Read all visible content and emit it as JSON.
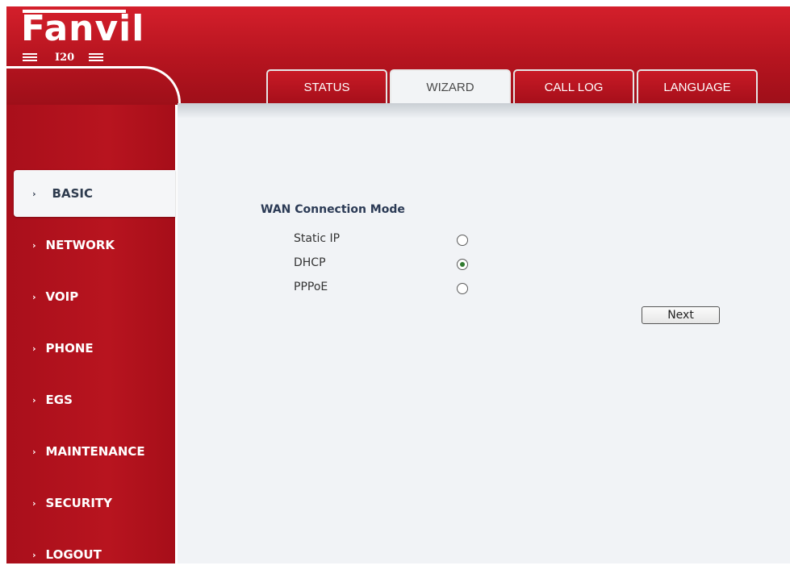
{
  "brand": {
    "logo": "Fanvil",
    "model": "I20"
  },
  "tabs": [
    {
      "label": "STATUS"
    },
    {
      "label": "WIZARD",
      "active": true
    },
    {
      "label": "CALL LOG"
    },
    {
      "label": "LANGUAGE"
    }
  ],
  "sidebar": {
    "items": [
      {
        "label": "BASIC",
        "active": true
      },
      {
        "label": "NETWORK"
      },
      {
        "label": "VOIP"
      },
      {
        "label": "PHONE"
      },
      {
        "label": "EGS"
      },
      {
        "label": "MAINTENANCE"
      },
      {
        "label": "SECURITY"
      },
      {
        "label": "LOGOUT"
      }
    ]
  },
  "wizard": {
    "title": "WAN Connection Mode",
    "options": [
      {
        "label": "Static IP",
        "selected": false
      },
      {
        "label": "DHCP",
        "selected": true
      },
      {
        "label": "PPPoE",
        "selected": false
      }
    ],
    "next_label": "Next"
  },
  "colors": {
    "brand_red": "#b5141f",
    "content_bg": "#f1f3f6",
    "title_text": "#2b3a55"
  }
}
